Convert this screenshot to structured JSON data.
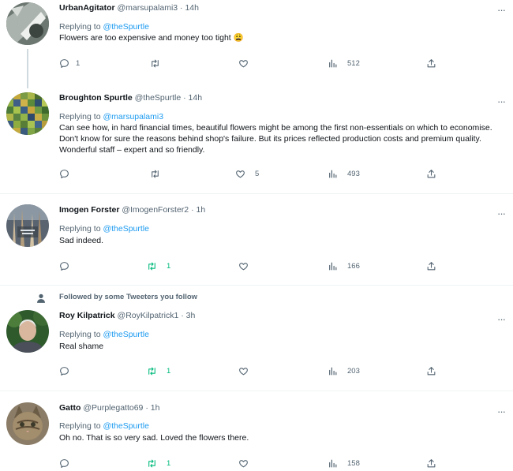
{
  "tweets": [
    {
      "name": "UrbanAgitator",
      "handle": "@marsupalami3",
      "time": "14h",
      "replying_prefix": "Replying to",
      "replying_to": "@theSpurtle",
      "text": "Flowers are too expensive and money too tight 😩",
      "replies": "1",
      "retweets": "",
      "likes": "",
      "views": "512"
    },
    {
      "name": "Broughton Spurtle",
      "handle": "@theSpurtle",
      "time": "14h",
      "replying_prefix": "Replying to",
      "replying_to": "@marsupalami3",
      "text": "Can see how, in hard financial times, beautiful flowers might be among the first non-essentials on which to economise. Don't know for sure the reasons behind shop's failure. But its prices reflected production costs and premium quality. Wonderful staff – expert and so friendly.",
      "replies": "",
      "retweets": "",
      "likes": "5",
      "views": "493"
    },
    {
      "name": "Imogen Forster",
      "handle": "@ImogenForster2",
      "time": "1h",
      "replying_prefix": "Replying to",
      "replying_to": "@theSpurtle",
      "text": "Sad indeed.",
      "replies": "",
      "retweets": "1",
      "likes": "",
      "views": "166"
    },
    {
      "social_context": "Followed by some Tweeters you follow",
      "name": "Roy Kilpatrick",
      "handle": "@RoyKilpatrick1",
      "time": "3h",
      "replying_prefix": "Replying to",
      "replying_to": "@theSpurtle",
      "text": "Real shame",
      "replies": "",
      "retweets": "1",
      "likes": "",
      "views": "203"
    },
    {
      "name": "Gatto",
      "handle": "@Purplegatto69",
      "time": "1h",
      "replying_prefix": "Replying to",
      "replying_to": "@theSpurtle",
      "text": "Oh no. That is so very sad. Loved the flowers there.",
      "replies": "",
      "retweets": "1",
      "likes": "",
      "views": "158"
    }
  ],
  "separator": "·",
  "more_glyph": "···",
  "colors": {
    "link": "#1d9bf0",
    "secondary": "#536471",
    "retweet_active": "#00ba7c",
    "divider": "#eff3f4"
  },
  "icons": [
    "reply-icon",
    "retweet-icon",
    "like-icon",
    "views-icon",
    "share-icon",
    "more-icon",
    "person-icon"
  ]
}
